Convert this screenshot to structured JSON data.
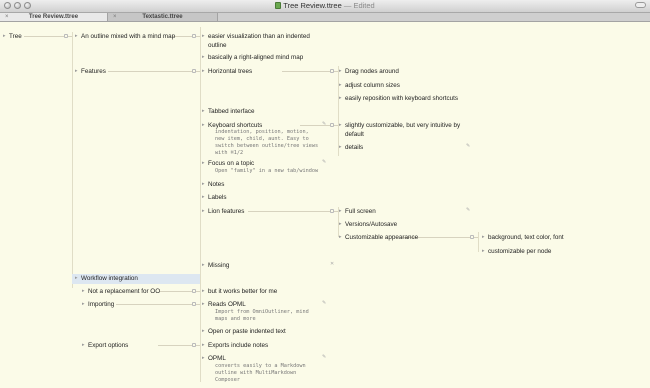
{
  "window": {
    "title": "Tree Review.ttree",
    "status": "— Edited"
  },
  "tabs": [
    {
      "label": "Tree Review.ttree"
    },
    {
      "label": "Textastic.ttree"
    }
  ],
  "tree": {
    "root": "Tree",
    "col1": {
      "mindmap": "An outline mixed with a mind map",
      "features": "Features",
      "workflow": "Workflow integration",
      "not_replacement": "Not a replacement for OO",
      "importing": "Importing",
      "export": "Export options"
    },
    "col2": {
      "easier": "easier visualization than an indented outline",
      "right_aligned": "basically a right-aligned mind map",
      "horizontal": "Horizontal trees",
      "tabbed": "Tabbed interface",
      "keyboard": "Keyboard shortcuts",
      "keyboard_note": "indentation, position, motion,\nnew item, child, aunt. Easy to\nswitch between outline/tree views\nwith ⌘1/2",
      "focus": "Focus on a topic",
      "focus_note": "Open \"family\" in a new tab/window",
      "notes": "Notes",
      "labels": "Labels",
      "lion": "Lion features",
      "missing": "Missing",
      "works_better": "but it works better for me",
      "reads_opml": "Reads OPML",
      "reads_opml_note": "Import from OmniOutliner, mind\nmaps and more",
      "open_paste": "Open or paste indented text",
      "exports_notes": "Exports include notes",
      "opml": "OPML",
      "opml_note": "converts easily to a Markdown\noutline with MultiMarkdown\nComposer"
    },
    "col3": {
      "drag": "Drag nodes around",
      "adjust": "adjust column sizes",
      "reposition": "easily reposition with keyboard shortcuts",
      "customizable": "slightly customizable, but very intuitive by default",
      "details": "details",
      "fullscreen": "Full screen",
      "versions": "Versions/Autosave",
      "custom_appearance": "Customizable appearance"
    },
    "col4": {
      "bg": "background, text color, font",
      "per_node": "customizable per node"
    }
  },
  "colors": {
    "background": "#fbfbe8",
    "selection": "#dde7f1",
    "line": "#d7d3bf"
  }
}
